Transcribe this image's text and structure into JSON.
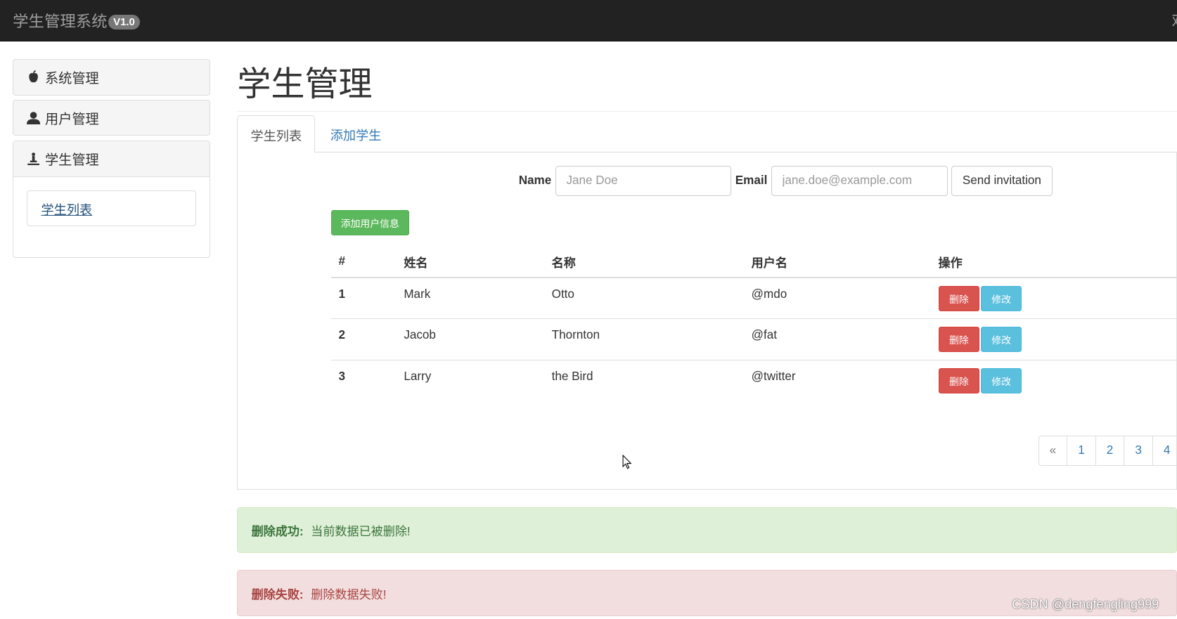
{
  "navbar": {
    "brand": "学生管理系统",
    "version": "V1.0",
    "right_text": "欢"
  },
  "sidebar": {
    "panels": [
      {
        "label": "系统管理",
        "icon": "apple-icon"
      },
      {
        "label": "用户管理",
        "icon": "user-icon"
      },
      {
        "label": "学生管理",
        "icon": "pawn-icon"
      }
    ],
    "sub_items": [
      {
        "label": "学生列表"
      }
    ]
  },
  "main": {
    "title": "学生管理",
    "tabs": [
      {
        "label": "学生列表",
        "active": true
      },
      {
        "label": "添加学生",
        "active": false
      }
    ],
    "form": {
      "name_label": "Name",
      "name_placeholder": "Jane Doe",
      "name_value": "",
      "email_label": "Email",
      "email_placeholder": "jane.doe@example.com",
      "email_value": "",
      "submit_label": "Send invitation"
    },
    "add_button": "添加用户信息",
    "table": {
      "headers": [
        "#",
        "姓名",
        "名称",
        "用户名",
        "操作"
      ],
      "rows": [
        {
          "id": "1",
          "first": "Mark",
          "last": "Otto",
          "username": "@mdo"
        },
        {
          "id": "2",
          "first": "Jacob",
          "last": "Thornton",
          "username": "@fat"
        },
        {
          "id": "3",
          "first": "Larry",
          "last": "the Bird",
          "username": "@twitter"
        }
      ],
      "delete_label": "删除",
      "edit_label": "修改"
    },
    "pagination": [
      "«",
      "1",
      "2",
      "3",
      "4"
    ],
    "alerts": {
      "success": {
        "title": "删除成功:",
        "message": "当前数据已被删除!"
      },
      "error": {
        "title": "删除失败:",
        "message": "删除数据失败!"
      }
    }
  },
  "watermark": "CSDN @dengfengling999",
  "colors": {
    "success": "#5cb85c",
    "danger": "#d9534f",
    "info": "#5bc0de",
    "link": "#337ab7",
    "navbar": "#222222"
  }
}
